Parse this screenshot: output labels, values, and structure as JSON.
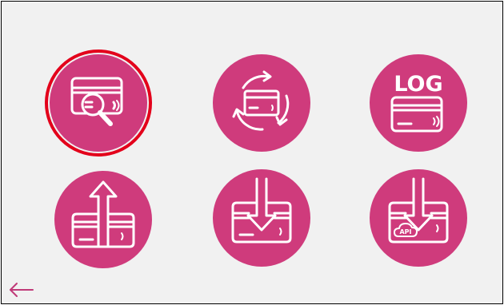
{
  "colors": {
    "tile": "#cf3b7c",
    "highlight": "#e3001b",
    "background": "#f1f1f1",
    "icon": "#ffffff",
    "back_arrow": "#c03a78"
  },
  "tiles": [
    {
      "name": "card-inspect",
      "icon": "card-magnifier-icon",
      "selected": true
    },
    {
      "name": "card-sync",
      "icon": "card-cycle-icon",
      "selected": false
    },
    {
      "name": "card-log",
      "icon": "card-log-icon",
      "label": "LOG",
      "selected": false
    },
    {
      "name": "card-upload",
      "icon": "card-upload-icon",
      "selected": false
    },
    {
      "name": "card-download",
      "icon": "card-download-icon",
      "selected": false
    },
    {
      "name": "card-api-download",
      "icon": "card-api-download-icon",
      "label": "API",
      "selected": false
    }
  ],
  "back": {
    "icon": "back-arrow-icon"
  }
}
